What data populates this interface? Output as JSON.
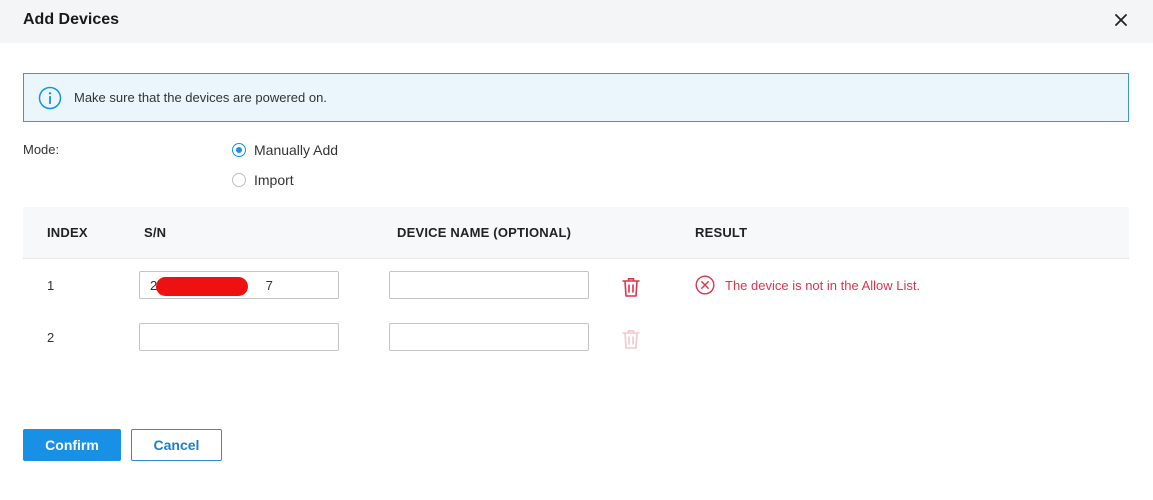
{
  "dialog": {
    "title": "Add Devices"
  },
  "notice": {
    "text": "Make sure that the devices are powered on."
  },
  "mode": {
    "label": "Mode:",
    "options": [
      {
        "label": "Manually Add",
        "selected": true
      },
      {
        "label": "Import",
        "selected": false
      }
    ]
  },
  "table": {
    "headers": {
      "index": "INDEX",
      "sn": "S/N",
      "device_name": "DEVICE NAME (OPTIONAL)",
      "result": "RESULT"
    },
    "rows": [
      {
        "index": "1",
        "sn": "2                              7",
        "device_name": "",
        "result": "The device is not in the Allow List."
      },
      {
        "index": "2",
        "sn": "",
        "device_name": "",
        "result": ""
      }
    ]
  },
  "buttons": {
    "confirm": "Confirm",
    "cancel": "Cancel"
  },
  "colors": {
    "primary": "#1890e6",
    "error": "#e0344a",
    "notice_border": "#3c9bc2",
    "notice_bg": "#ebf6fc"
  },
  "icons": {
    "close": "close-icon",
    "info": "info-icon",
    "trash": "trash-icon",
    "error": "error-circle-icon"
  }
}
